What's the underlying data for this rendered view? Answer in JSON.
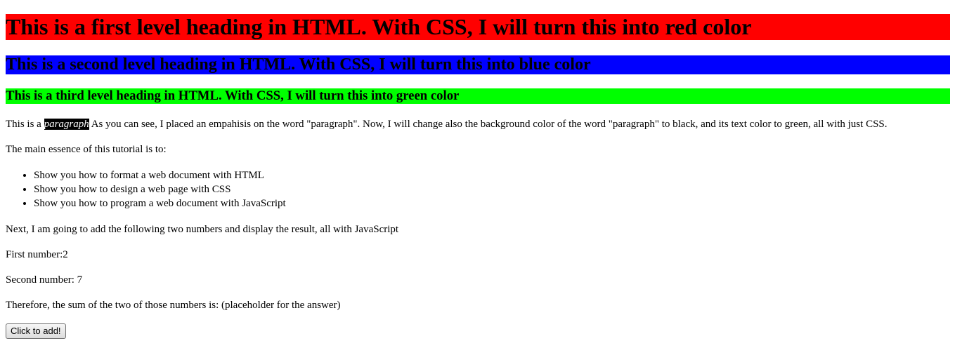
{
  "headings": {
    "h1": "This is a first level heading in HTML. With CSS, I will turn this into red color",
    "h2": "This is a second level heading in HTML. With CSS, I will turn this into blue color",
    "h3": "This is a third level heading in HTML. With CSS, I will turn this into green color"
  },
  "intro": {
    "before": "This is a ",
    "emphasis": "paragraph",
    "after": " As you can see, I placed an empahisis on the word \"paragraph\". Now, I will change also the background color of the word \"paragraph\" to black, and its text color to green, all with just CSS."
  },
  "essence_text": "The main essence of this tutorial is to:",
  "list_items": [
    "Show you how to format a web document with HTML",
    "Show you how to design a web page with CSS",
    "Show you how to program a web document with JavaScript"
  ],
  "next_text": "Next, I am going to add the following two numbers and display the result, all with JavaScript",
  "first_number": "First number:2",
  "second_number": "Second number: 7",
  "sum_text": "Therefore, the sum of the two of those numbers is: (placeholder for the answer)",
  "button_label": "Click to add!",
  "colors": {
    "h1_bg": "#ff0000",
    "h2_bg": "#0000ff",
    "h3_bg": "#00ff00",
    "emphasis_bg": "#000000",
    "emphasis_fg": "#ffffff"
  }
}
